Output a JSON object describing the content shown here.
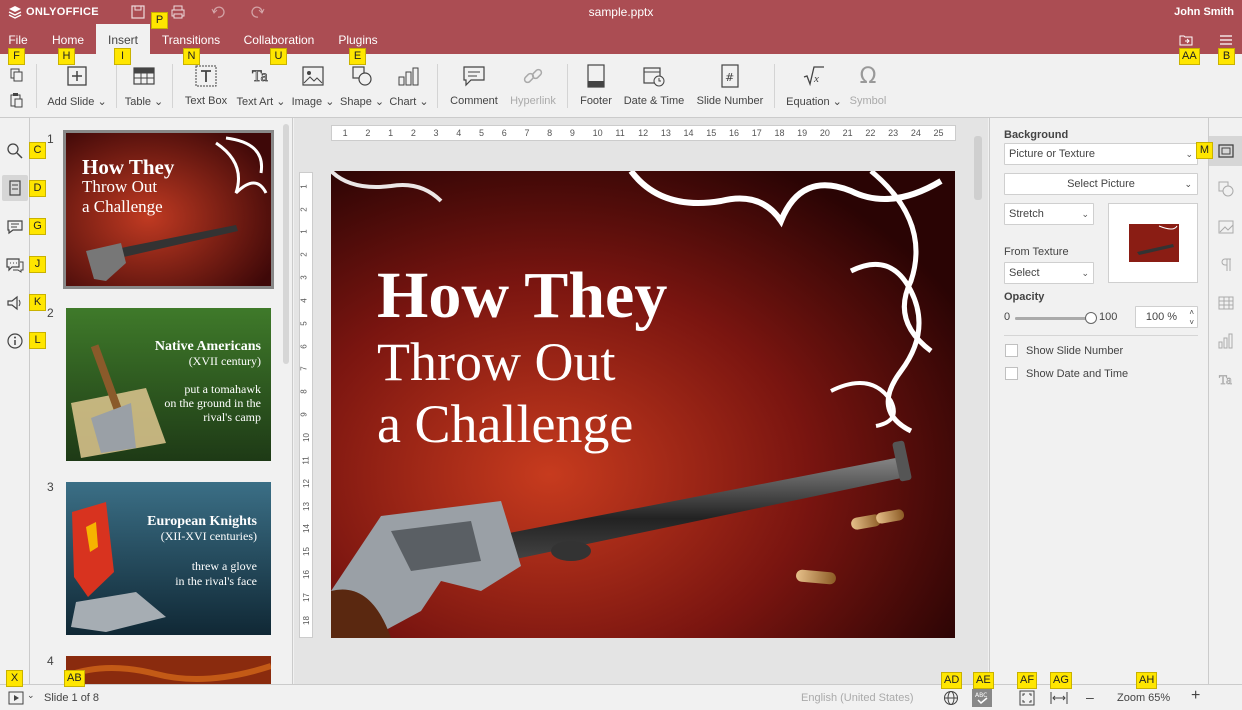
{
  "app": {
    "logo_text": "ONLYOFFICE",
    "doc_title": "sample.pptx",
    "user": "John Smith",
    "brand_color": "#ab4d53"
  },
  "tabs": [
    {
      "label": "File"
    },
    {
      "label": "Home"
    },
    {
      "label": "Insert",
      "active": true
    },
    {
      "label": "Transitions"
    },
    {
      "label": "Collaboration"
    },
    {
      "label": "Plugins"
    }
  ],
  "toolbar": {
    "add_slide": "Add Slide",
    "table": "Table",
    "text_box": "Text Box",
    "text_art": "Text Art",
    "image": "Image",
    "shape": "Shape",
    "chart": "Chart",
    "comment": "Comment",
    "hyperlink": "Hyperlink",
    "footer": "Footer",
    "date_time": "Date & Time",
    "slide_number": "Slide Number",
    "equation": "Equation",
    "symbol": "Symbol"
  },
  "slides": [
    {
      "num": "1",
      "title1": "How They",
      "title2": "Throw Out",
      "title3": "a Challenge",
      "selected": true
    },
    {
      "num": "2",
      "heading": "Native Americans",
      "sub": "(XVII century)",
      "text1": "put a tomahawk",
      "text2": "on the ground in the",
      "text3": "rival's camp"
    },
    {
      "num": "3",
      "heading": "European Knights",
      "sub": "(XII-XVI centuries)",
      "text1": "threw a glove",
      "text2": "in the rival's face"
    },
    {
      "num": "4"
    }
  ],
  "ruler": {
    "h_ticks": [
      "1",
      "2",
      "1",
      "2",
      "3",
      "4",
      "5",
      "6",
      "7",
      "8",
      "9",
      "10",
      "11",
      "12",
      "13",
      "14",
      "15",
      "16",
      "17",
      "18",
      "19",
      "20",
      "21",
      "22",
      "23",
      "24",
      "25"
    ],
    "v_ticks": [
      "1",
      "2",
      "1",
      "2",
      "3",
      "4",
      "5",
      "6",
      "7",
      "8",
      "9",
      "10",
      "11",
      "12",
      "13",
      "14",
      "15",
      "16",
      "17",
      "18"
    ]
  },
  "main_slide": {
    "line1": "How They",
    "line2": "Throw Out",
    "line3": "a Challenge"
  },
  "right_panel": {
    "background_label": "Background",
    "fill_type": "Picture or Texture",
    "select_picture": "Select Picture",
    "stretch": "Stretch",
    "from_texture_label": "From Texture",
    "texture_select": "Select",
    "opacity_label": "Opacity",
    "opacity_min": "0",
    "opacity_max": "100",
    "opacity_value": "100 %",
    "opacity_level": 1.0,
    "show_slide_number": "Show Slide Number",
    "show_date_time": "Show Date and Time"
  },
  "status": {
    "slide_of": "Slide 1 of 8",
    "language": "English (United States)",
    "zoom": "Zoom 65%",
    "minus": "–",
    "plus": "+"
  },
  "hint_tags": {
    "F": "F",
    "H": "H",
    "I": "I",
    "N": "N",
    "U": "U",
    "E": "E",
    "P": "P",
    "AA": "AA",
    "B": "B",
    "C": "C",
    "D": "D",
    "G": "G",
    "J": "J",
    "K": "K",
    "L": "L",
    "M": "M",
    "X": "X",
    "AB": "AB",
    "AD": "AD",
    "AE": "AE",
    "AF": "AF",
    "AG": "AG",
    "AH": "AH"
  }
}
